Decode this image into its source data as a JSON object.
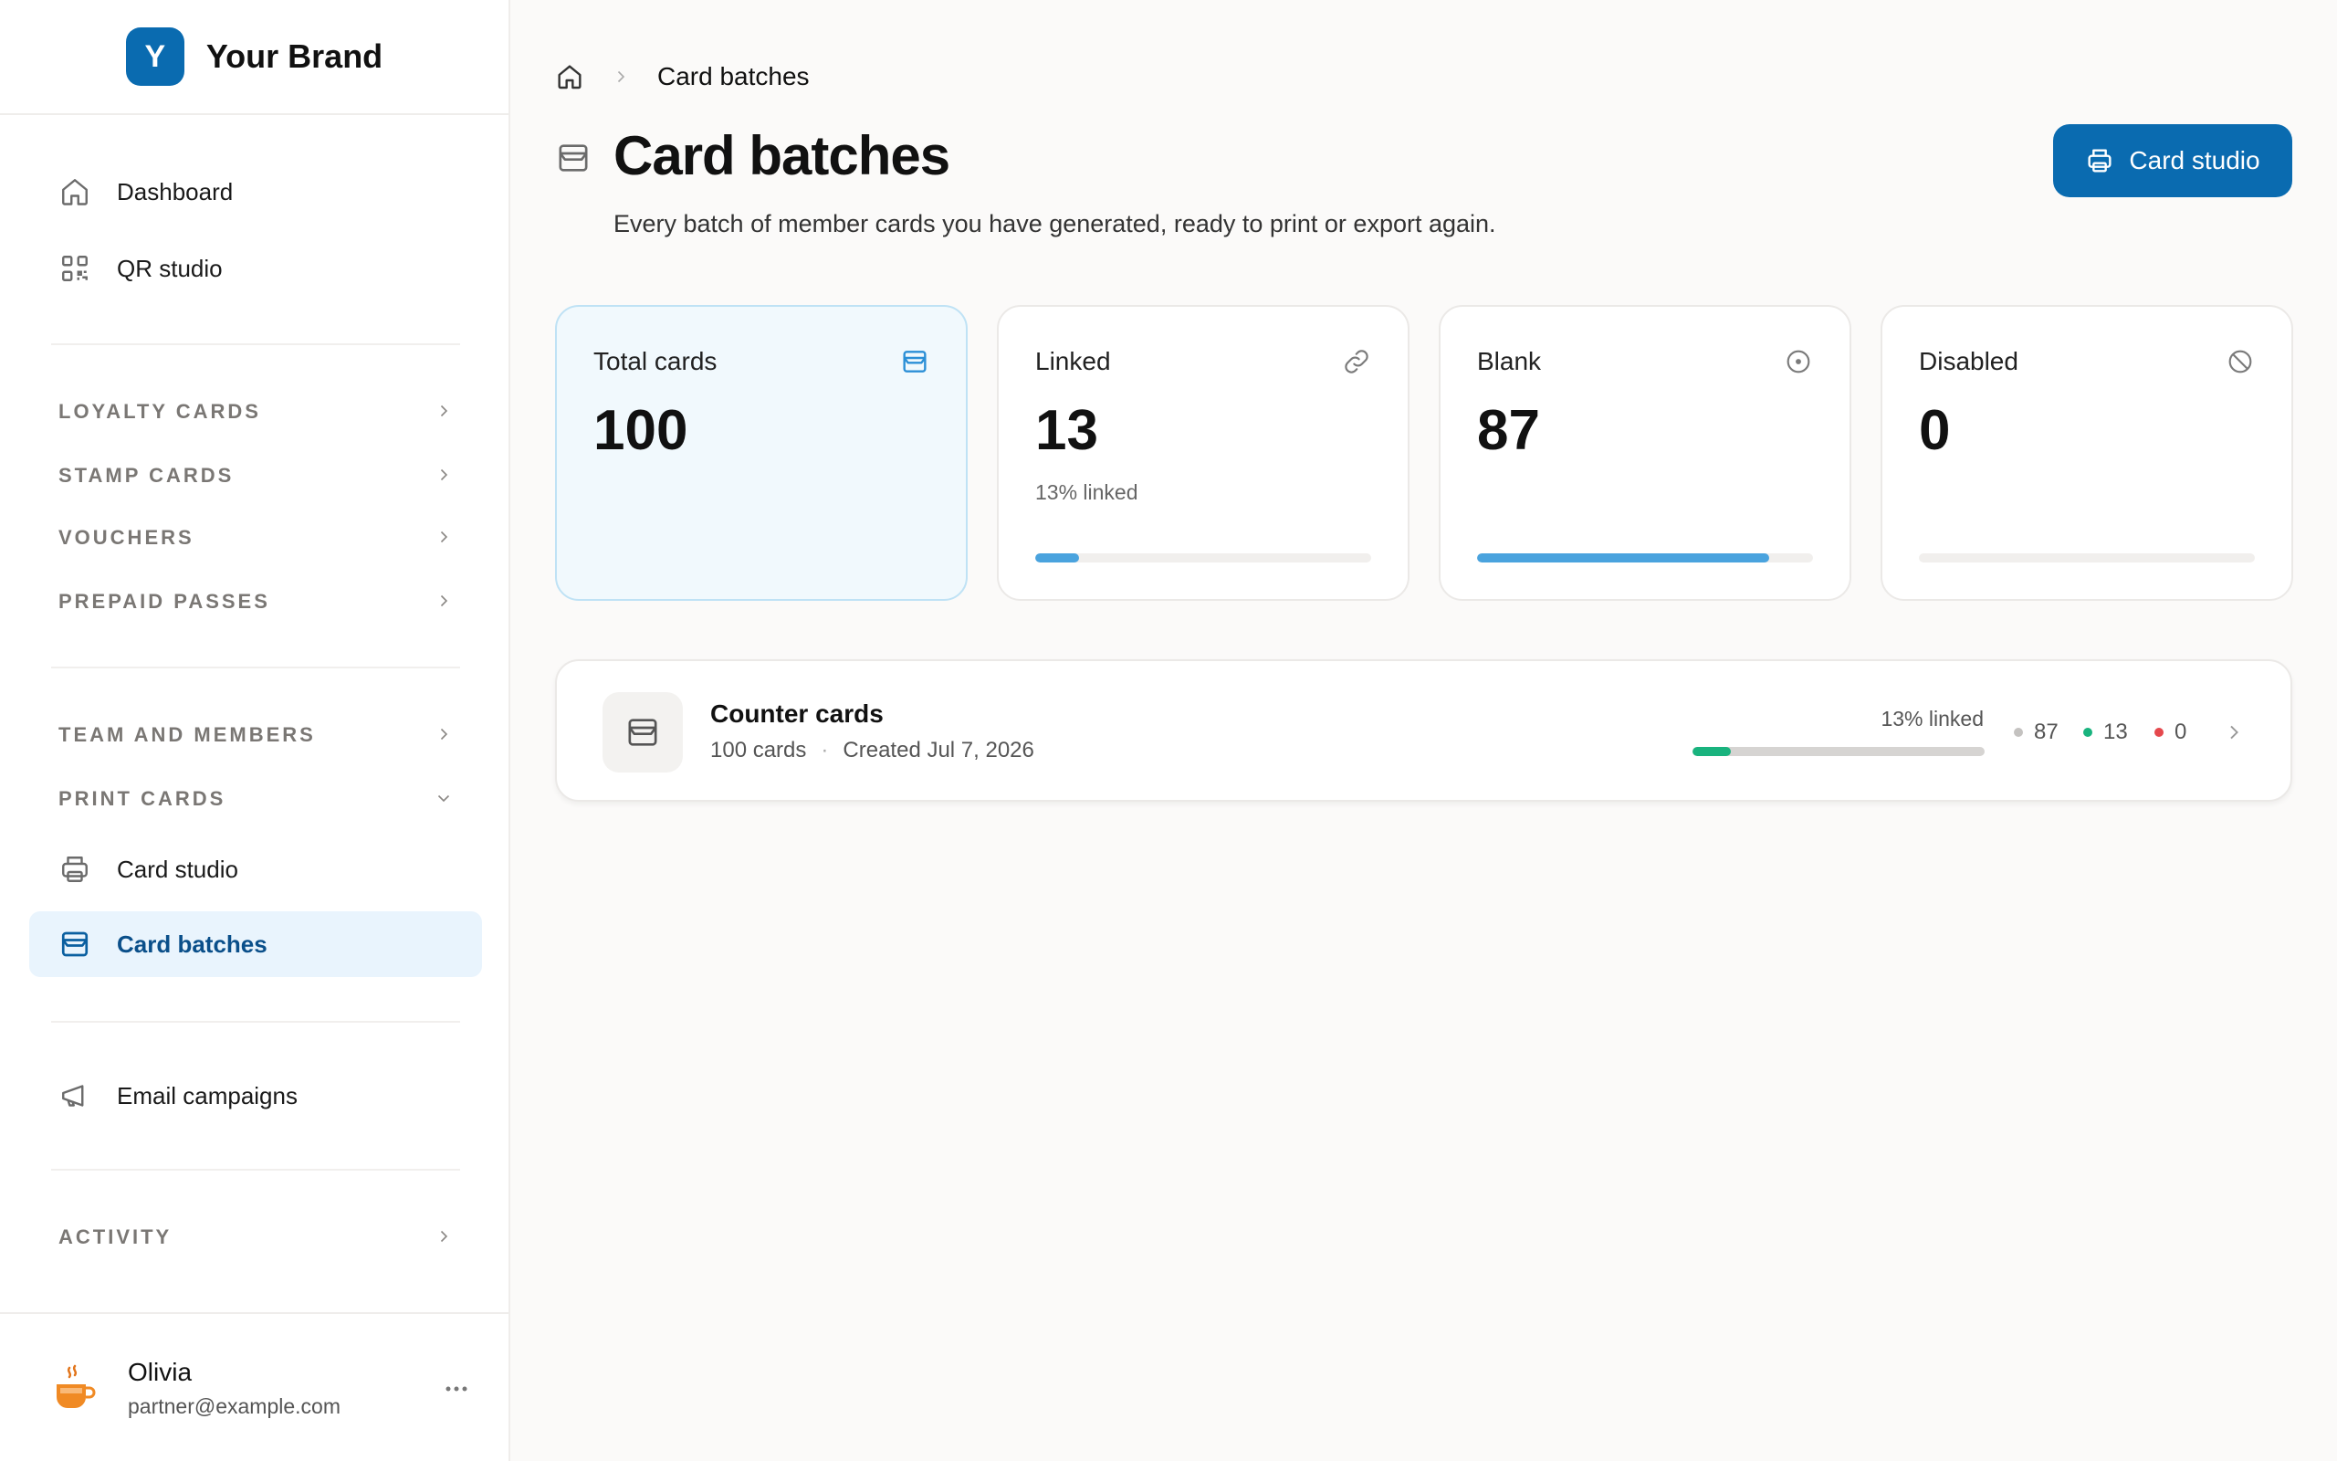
{
  "brand": {
    "initial": "Y",
    "name": "Your Brand",
    "color": "#0a6bb0"
  },
  "sidebar": {
    "top_items": [
      {
        "label": "Dashboard",
        "icon": "home-icon"
      },
      {
        "label": "QR studio",
        "icon": "qr-code-icon"
      }
    ],
    "sections": [
      {
        "label": "LOYALTY CARDS",
        "expanded": false
      },
      {
        "label": "STAMP CARDS",
        "expanded": false
      },
      {
        "label": "VOUCHERS",
        "expanded": false
      },
      {
        "label": "PREPAID PASSES",
        "expanded": false
      },
      {
        "label": "TEAM AND MEMBERS",
        "expanded": false
      },
      {
        "label": "PRINT CARDS",
        "expanded": true
      },
      {
        "label": "ACTIVITY",
        "expanded": false
      }
    ],
    "print_items": [
      {
        "label": "Card studio",
        "icon": "printer-icon",
        "active": false
      },
      {
        "label": "Card batches",
        "icon": "inbox-icon",
        "active": true
      }
    ],
    "email_item": {
      "label": "Email campaigns",
      "icon": "megaphone-icon"
    },
    "user": {
      "name": "Olivia",
      "email": "partner@example.com",
      "avatar_icon": "coffee-cup-icon"
    }
  },
  "breadcrumb": {
    "home_icon": "home-icon",
    "current": "Card batches"
  },
  "header": {
    "title": "Card batches",
    "subtitle": "Every batch of member cards you have generated, ready to print or export again.",
    "primary_button": "Card studio"
  },
  "stats": [
    {
      "label": "Total cards",
      "value": "100",
      "note": "",
      "icon": "inbox-icon",
      "progress": null,
      "highlight": true
    },
    {
      "label": "Linked",
      "value": "13",
      "note": "13% linked",
      "icon": "link-icon",
      "progress": 0.13,
      "highlight": false
    },
    {
      "label": "Blank",
      "value": "87",
      "note": "",
      "icon": "circle-dot-icon",
      "progress": 0.87,
      "highlight": false
    },
    {
      "label": "Disabled",
      "value": "0",
      "note": "",
      "icon": "ban-icon",
      "progress": 0,
      "highlight": false
    }
  ],
  "batches": [
    {
      "name": "Counter cards",
      "count_text": "100 cards",
      "created_text": "Created Jul 7, 2026",
      "linked_text": "13% linked",
      "linked_fraction": 0.13,
      "blank": "87",
      "linked": "13",
      "disabled": "0"
    }
  ],
  "colors": {
    "accent": "#0a6bb0",
    "progress_blue": "#4aa3de",
    "linked_green": "#19b37e",
    "blank_gray": "#c4c2c0",
    "disabled_red": "#e5484d"
  }
}
